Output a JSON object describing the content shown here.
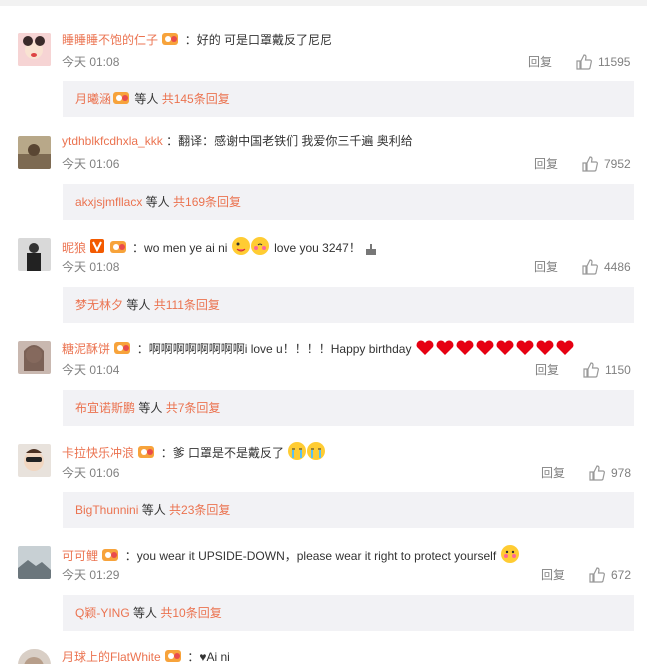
{
  "comments": [
    {
      "user": "睡睡睡不饱的仁子",
      "text": "：好的 可是口罩戴反了尼尼",
      "time": "今天 01:08",
      "reply": "回复",
      "likes": "11595",
      "sub_user": "月曦涵",
      "sub_mid": " 等人 ",
      "sub_link": "共145条回复"
    },
    {
      "user": "ytdhblkfcdhxla_kkk",
      "text": "：翻译：感谢中国老铁们 我爱你三千遍 奥利给",
      "time": "今天 01:06",
      "reply": "回复",
      "likes": "7952",
      "sub_user": "akxjsjmfllacx",
      "sub_mid": " 等人 ",
      "sub_link": "共169条回复"
    },
    {
      "user": "昵狼",
      "text_a": "：wo men ye ai ni",
      "text_b": " love you 3247！",
      "time": "今天 01:08",
      "reply": "回复",
      "likes": "4486",
      "sub_user": "梦无林夕",
      "sub_mid": " 等人 ",
      "sub_link": "共111条回复"
    },
    {
      "user": "糖泥酥饼",
      "text": "：啊啊啊啊啊啊啊啊i love u！！！！Happy birthday",
      "time": "今天 01:04",
      "reply": "回复",
      "likes": "1150",
      "sub_user": "布宜诺斯鹏",
      "sub_mid": " 等人 ",
      "sub_link": "共7条回复"
    },
    {
      "user": "卡拉快乐冲浪",
      "text": "：爹 口罩是不是戴反了",
      "time": "今天 01:06",
      "reply": "回复",
      "likes": "978",
      "sub_user": "BigThunnini",
      "sub_mid": " 等人 ",
      "sub_link": "共23条回复"
    },
    {
      "user": "可可鲤",
      "text": "：you wear it UPSIDE-DOWN，please wear it right to protect yourself",
      "time": "今天 01:29",
      "reply": "回复",
      "likes": "672",
      "sub_user": "Q颖-YING",
      "sub_mid": " 等人 ",
      "sub_link": "共10条回复"
    },
    {
      "user": "月球上的FlatWhite",
      "text": "：♥Ai ni"
    }
  ],
  "colors": {
    "username": "#eb7350",
    "meta": "#808080",
    "subbox": "#f2f2f5"
  },
  "icons": {
    "like": "thumb-up-icon",
    "badge": "vip-crown-icon",
    "verified": "v-badge-icon"
  }
}
